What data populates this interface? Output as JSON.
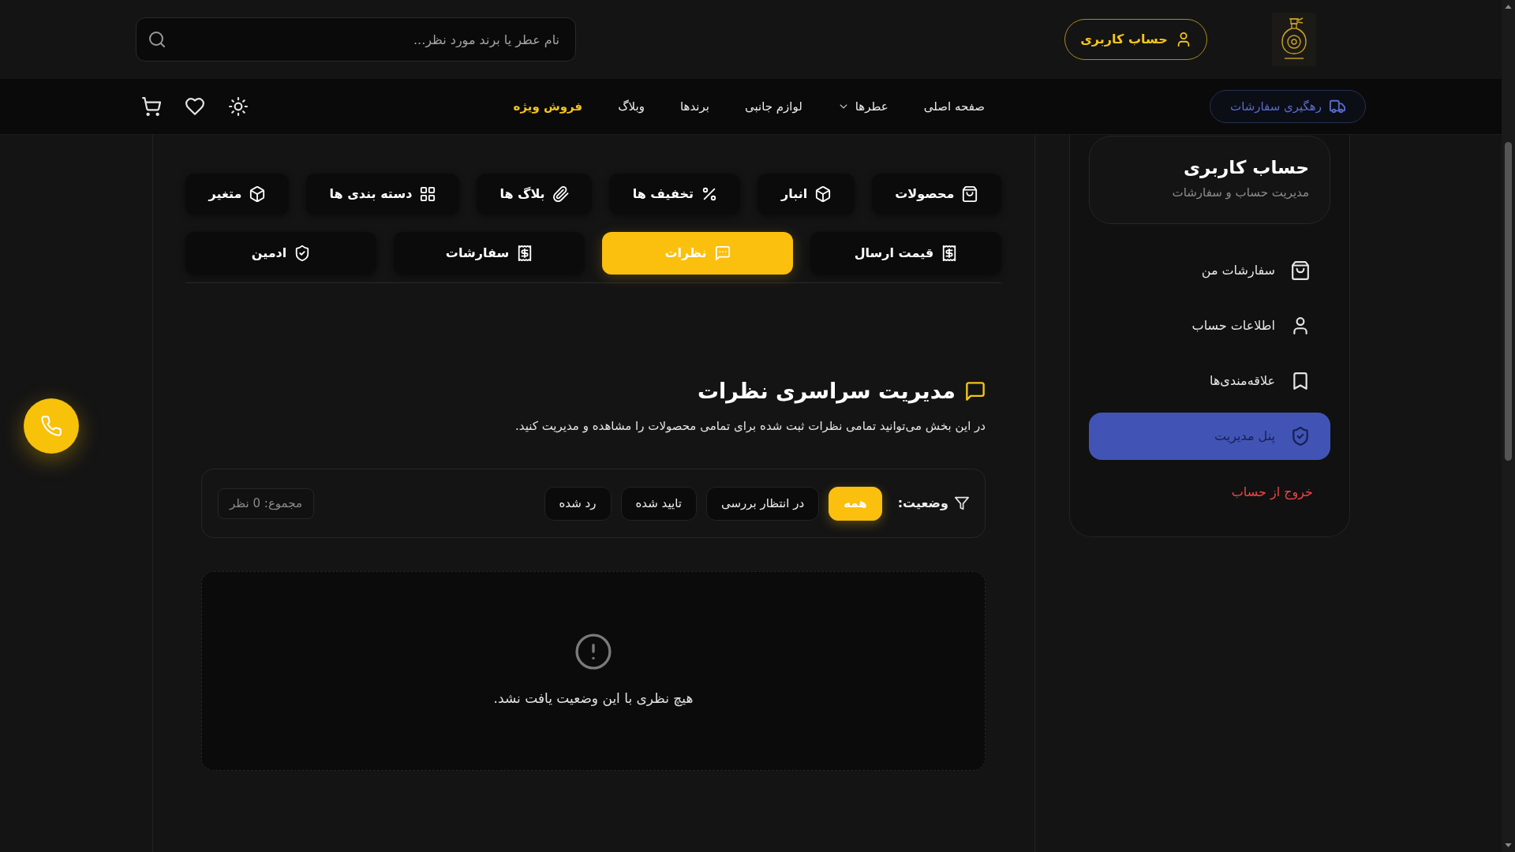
{
  "header": {
    "account_button": "حساب کاربری",
    "search": {
      "placeholder": "نام عطر یا برند مورد نظر..."
    }
  },
  "nav": {
    "tracking_button": "رهگیری سفارشات",
    "links": [
      {
        "label": "صفحه اصلی",
        "kind": "plain"
      },
      {
        "label": "عطرها",
        "kind": "dropdown"
      },
      {
        "label": "لوازم جانبی",
        "kind": "plain"
      },
      {
        "label": "برندها",
        "kind": "plain"
      },
      {
        "label": "وبلاگ",
        "kind": "plain"
      },
      {
        "label": "فروش ویژه",
        "kind": "featured"
      }
    ]
  },
  "sidebar": {
    "title": "حساب کاربری",
    "subtitle": "مدیریت حساب و سفارشات",
    "items": [
      {
        "label": "سفارشات من",
        "selected": false
      },
      {
        "label": "اطلاعات حساب",
        "selected": false
      },
      {
        "label": "علاقه‌مندی‌ها",
        "selected": false
      },
      {
        "label": "پنل مدیریت",
        "selected": true
      }
    ],
    "logout": "خروج از حساب"
  },
  "admin_tabs": [
    {
      "label": "محصولات",
      "selected": false
    },
    {
      "label": "انبار",
      "selected": false
    },
    {
      "label": "تخفیف ها",
      "selected": false
    },
    {
      "label": "بلاگ ها",
      "selected": false
    },
    {
      "label": "دسته بندی ها",
      "selected": false
    },
    {
      "label": "متغیر",
      "selected": false
    },
    {
      "label": "قیمت ارسال",
      "selected": false
    },
    {
      "label": "نظرات",
      "selected": true
    },
    {
      "label": "سفارشات",
      "selected": false
    },
    {
      "label": "ادمین",
      "selected": false
    }
  ],
  "comments": {
    "title": "مدیریت سراسری نظرات",
    "description": "در این بخش می‌توانید تمامی نظرات ثبت شده برای تمامی محصولات را مشاهده و مدیریت کنید.",
    "filter": {
      "label": "وضعیت:",
      "options": [
        {
          "label": "همه",
          "selected": true
        },
        {
          "label": "در انتظار بررسی",
          "selected": false
        },
        {
          "label": "تایید شده",
          "selected": false
        },
        {
          "label": "رد شده",
          "selected": false
        }
      ],
      "total": "مجموع: 0 نظر"
    },
    "empty_message": "هیچ نظری با این وضعیت یافت نشد."
  }
}
